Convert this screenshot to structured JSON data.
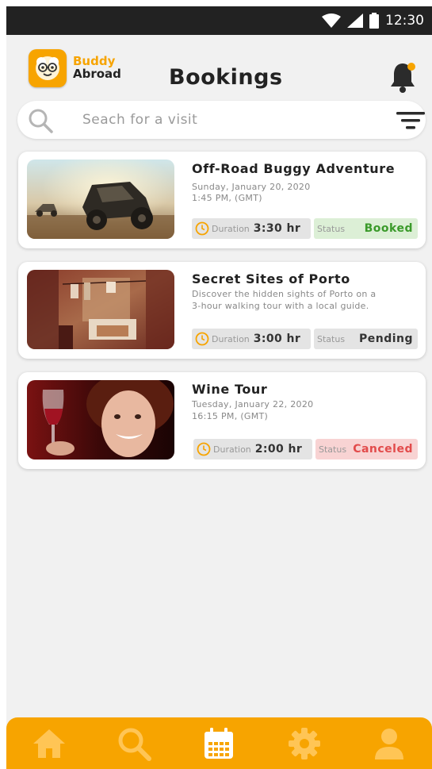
{
  "status_bar": {
    "time": "12:30"
  },
  "header": {
    "logo_line1": "Buddy",
    "logo_line2": "Abroad",
    "title": "Bookings"
  },
  "search": {
    "placeholder": "Seach for a visit"
  },
  "bookings": [
    {
      "title": "Off-Road Buggy Adventure",
      "line1": "Sunday, January 20, 2020",
      "line2": "1:45 PM, (GMT)",
      "duration_label": "Duration",
      "duration_value": "3:30 hr",
      "status_label": "Status",
      "status_value": "Booked",
      "status_color": "#3a9a2a",
      "status_bg": "#dcefd6"
    },
    {
      "title": "Secret Sites of Porto",
      "line1": "Discover the hidden sights of Porto on a",
      "line2": "3-hour walking tour with a local guide.",
      "duration_label": "Duration",
      "duration_value": "3:00 hr",
      "status_label": "Status",
      "status_value": "Pending",
      "status_color": "#333333",
      "status_bg": "#e4e4e4"
    },
    {
      "title": "Wine Tour",
      "line1": "Tuesday, January 22, 2020",
      "line2": "16:15 PM, (GMT)",
      "duration_label": "Duration",
      "duration_value": "2:00 hr",
      "status_label": "Status",
      "status_value": "Canceled",
      "status_color": "#e24b4b",
      "status_bg": "#f8d3d3"
    }
  ],
  "bottom_nav": [
    {
      "icon": "home-icon"
    },
    {
      "icon": "search-icon"
    },
    {
      "icon": "calendar-icon"
    },
    {
      "icon": "gear-icon"
    },
    {
      "icon": "user-icon"
    }
  ],
  "colors": {
    "accent": "#f7a400"
  }
}
